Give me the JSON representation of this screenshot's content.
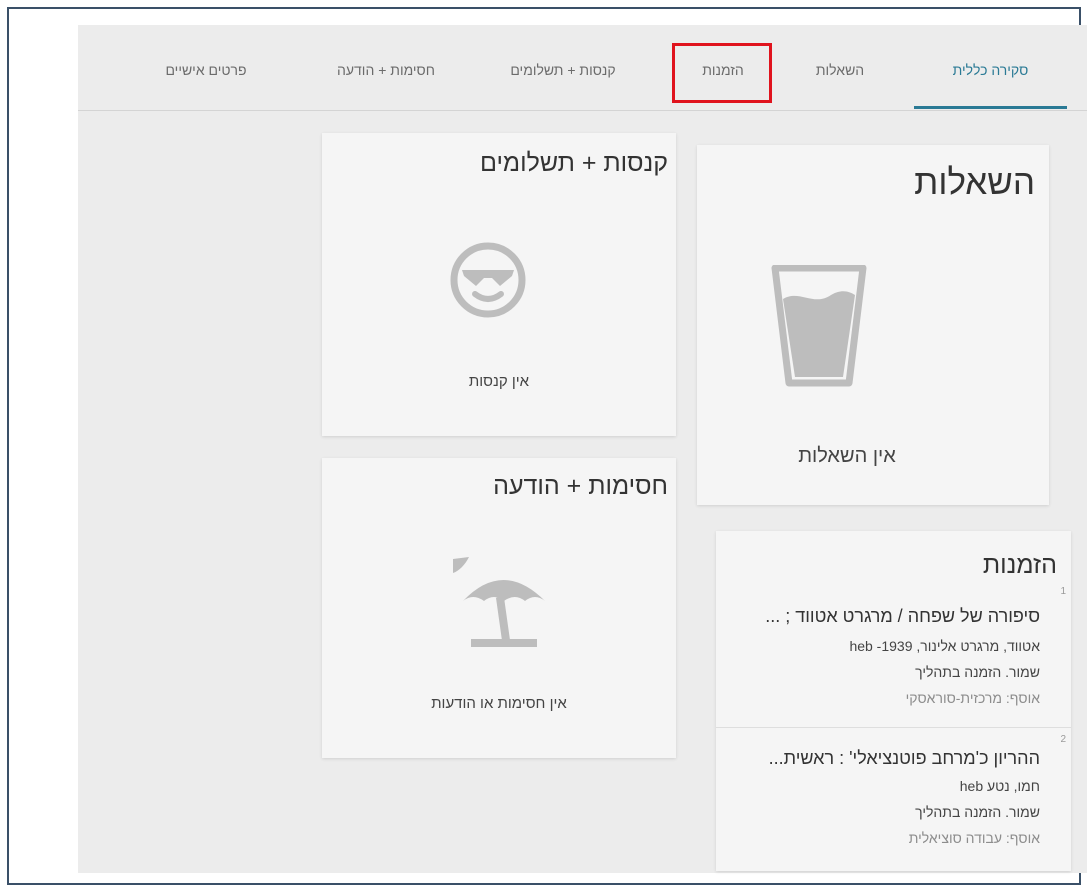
{
  "tabs": [
    {
      "label": "סקירה כללית",
      "active": true
    },
    {
      "label": "השאלות",
      "active": false
    },
    {
      "label": "הזמנות",
      "active": false,
      "highlighted": true
    },
    {
      "label": "קנסות + תשלומים",
      "active": false
    },
    {
      "label": "חסימות + הודעה",
      "active": false
    },
    {
      "label": "פרטים אישיים",
      "active": false
    }
  ],
  "colors": {
    "accent": "#2a7a95",
    "highlight": "#e0131d",
    "panel": "#ececec",
    "card": "#f5f5f5",
    "icon": "#bdbdbd"
  },
  "loans_card": {
    "title": "השאלות",
    "empty_text": "אין השאלות",
    "icon": "glass-icon"
  },
  "fines_card": {
    "title": "קנסות + תשלומים",
    "empty_text": "אין קנסות",
    "icon": "sunglasses-face-icon"
  },
  "blocks_card": {
    "title": "חסימות + הודעה",
    "empty_text": "אין חסימות או הודעות",
    "icon": "beach-umbrella-icon"
  },
  "requests_card": {
    "title": "הזמנות",
    "items": [
      {
        "number": "1",
        "title": "סיפורה של שפחה / מרגרט אטווד ; ...",
        "author": "אטווד, מרגרט אלינור, 1939- heb",
        "status": "שמור. הזמנה בתהליך",
        "collection": "אוסף: מרכזית-סוראסקי"
      },
      {
        "number": "2",
        "title": "ההריון כ'מרחב פוטנציאלי' : ראשית...",
        "author": "חמו, נטע heb",
        "status": "שמור. הזמנה בתהליך",
        "collection": "אוסף: עבודה סוציאלית"
      }
    ]
  }
}
